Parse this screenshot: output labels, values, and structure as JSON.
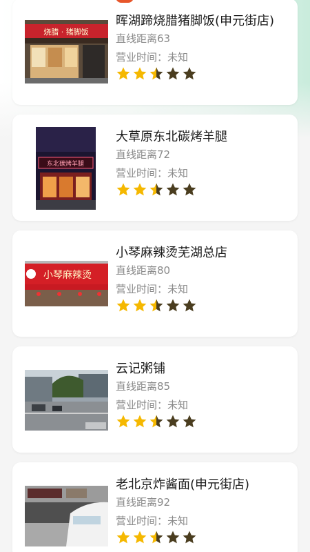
{
  "rating": {
    "filled": 2.5,
    "max": 5,
    "filled_color": "#f5b800",
    "empty_color": "#4a3d1f"
  },
  "restaurants": [
    {
      "name": "晖湖蹄烧腊猪脚饭(申元街店)",
      "distance": "直线距离63",
      "hours": "营业时间：未知",
      "image_icon": "storefront-photo",
      "sign_text": "烧腊 · 猪脚饭"
    },
    {
      "name": "大草原东北碳烤羊腿",
      "distance": "直线距离72",
      "hours": "营业时间：未知",
      "image_icon": "storefront-photo",
      "sign_text": "东北碳烤羊腿"
    },
    {
      "name": "小琴麻辣烫芜湖总店",
      "distance": "直线距离80",
      "hours": "营业时间：未知",
      "image_icon": "storefront-photo",
      "sign_text": "小琴麻辣烫"
    },
    {
      "name": "云记粥铺",
      "distance": "直线距离85",
      "hours": "营业时间：未知",
      "image_icon": "street-photo"
    },
    {
      "name": "老北京炸酱面(申元街店)",
      "distance": "直线距离92",
      "hours": "营业时间：未知",
      "image_icon": "street-photo"
    }
  ]
}
